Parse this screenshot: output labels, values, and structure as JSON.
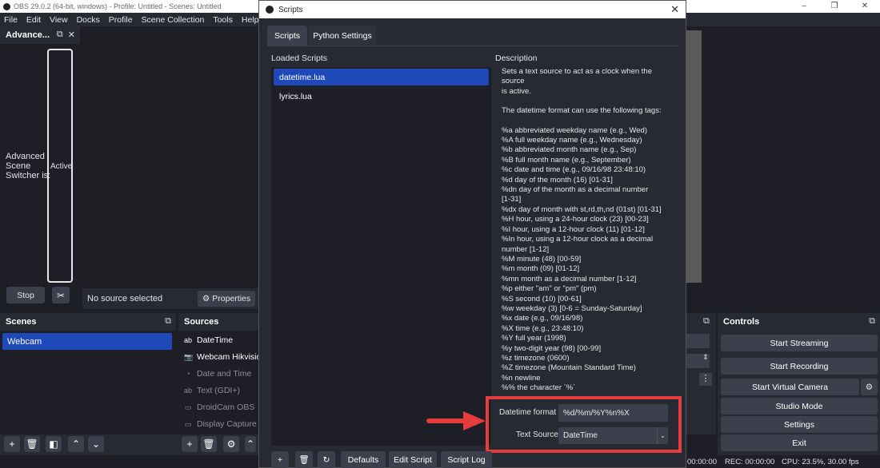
{
  "window": {
    "title": "OBS 29.0.2 (64-bit, windows) - Profile: Untitled - Scenes: Untitled",
    "min": "–",
    "max": "❐",
    "close": "✕"
  },
  "menu": [
    "File",
    "Edit",
    "View",
    "Docks",
    "Profile",
    "Scene Collection",
    "Tools",
    "Help"
  ],
  "advanced": {
    "header": "Advance...",
    "label_line1": "Advanced",
    "label_line2": "Scene",
    "label_line3": "Switcher is:",
    "active_text": "Active",
    "stop_label": "Stop"
  },
  "source_bar": {
    "no_source": "No source selected",
    "properties_label": "Properties"
  },
  "scenes": {
    "header": "Scenes",
    "items": [
      "Webcam"
    ]
  },
  "sources": {
    "header": "Sources",
    "items": [
      {
        "icon": "ab",
        "label": "DateTime",
        "dim": false
      },
      {
        "icon": "📷",
        "label": "Webcam Hikvisio",
        "dim": false
      },
      {
        "icon": "◔",
        "label": "Date and Time",
        "dim": true
      },
      {
        "icon": "ab",
        "label": "Text (GDI+)",
        "dim": true
      },
      {
        "icon": "▭",
        "label": "DroidCam OBS",
        "dim": true
      },
      {
        "icon": "▭",
        "label": "Display Capture",
        "dim": true
      }
    ]
  },
  "controls": {
    "header": "Controls",
    "buttons": [
      "Start Streaming",
      "Start Recording",
      "Start Virtual Camera",
      "Studio Mode",
      "Settings",
      "Exit"
    ]
  },
  "status": {
    "time": "00:00:00",
    "rec": "REC: 00:00:00",
    "cpu": "CPU: 23.5%, 30.00 fps"
  },
  "dialog": {
    "title": "Scripts",
    "tabs": [
      "Scripts",
      "Python Settings"
    ],
    "loaded_scripts_label": "Loaded Scripts",
    "description_label": "Description",
    "scripts": [
      "datetime.lua",
      "lyrics.lua"
    ],
    "description_lines": [
      "Sets a text source to act as a clock when the source",
      "is active.",
      "",
      "The datetime format can use the following tags:",
      "",
      "%a abbreviated weekday name (e.g., Wed)",
      "%A full weekday name (e.g., Wednesday)",
      "%b abbreviated month name (e.g., Sep)",
      "%B full month name (e.g., September)",
      "%c date and time (e.g., 09/16/98 23:48:10)",
      "%d day of the month (16) [01-31]",
      "%dn    day of the month as a decimal number",
      "[1-31]",
      "%dx day of month with st,rd,th,nd (01st) [01-31]",
      "%H hour, using a 24-hour clock (23) [00-23]",
      "%I hour, using a 12-hour clock (11) [01-12]",
      "%In    hour, using a 12-hour clock as a decimal",
      "number [1-12]",
      "%M minute (48) [00-59]",
      "%m month (09) [01-12]",
      "%mn    month as a decimal number [1-12]",
      "%p either \"am\" or \"pm\" (pm)",
      "%S second (10) [00-61]",
      "%w weekday (3) [0-6 = Sunday-Saturday]",
      "%x date (e.g., 09/16/98)",
      "%X time (e.g., 23:48:10)",
      "%Y full year (1998)",
      "%y two-digit year (98) [00-99]",
      "%z timezone (0600)",
      "%Z timezone (Mountain Standard Time)",
      "%n newline",
      "%% the character `%´"
    ],
    "datetime_format_label": "Datetime format",
    "datetime_format_value": "%d/%m/%Y%n%X",
    "text_source_label": "Text Source",
    "text_source_value": "DateTime",
    "buttons": {
      "defaults": "Defaults",
      "edit_script": "Edit Script",
      "script_log": "Script Log"
    }
  },
  "annotation_color": "#e53c3c"
}
